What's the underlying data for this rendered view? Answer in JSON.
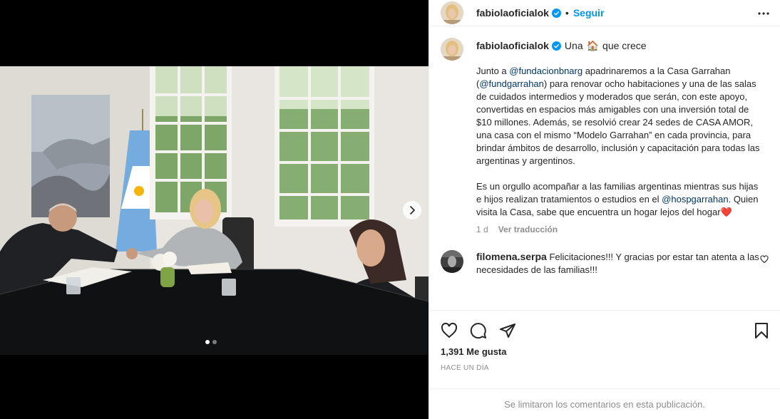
{
  "header": {
    "username": "fabiolaoficialok",
    "verified_icon": "verified-badge-icon",
    "separator": "•",
    "follow_label": "Seguir",
    "more_icon": "more-options-icon"
  },
  "caption": {
    "username": "fabiolaoficialok",
    "title_before": "Una",
    "title_emoji": "🏠",
    "title_after": "que crece",
    "p1_a": "Junto a ",
    "mention1": "@fundacionbnarg",
    "p1_b": " apadrinaremos a la Casa Garrahan (",
    "mention2": "@fundgarrahan",
    "p1_c": ") para renovar ocho habitaciones y una de las salas de cuidados intermedios y moderados que serán, con este apoyo, convertidas en espacios más amigables con una inversión total de $10 millones. Además, se resolvió crear 24 sedes de CASA AMOR, una casa con el mismo “Modelo Garrahan” en cada provincia, para brindar ámbitos de desarrollo, inclusión y capacitación para todas las argentinas y argentinos.\n\nEs un orgullo acompañar a las familias argentinas mientras sus hijas e hijos realizan tratamientos o estudios en el ",
    "mention3": "@hospgarrahan",
    "p1_d": ". Quien visita la Casa, sabe que encuentra un hogar lejos del hogar",
    "heart_emoji": "❤️",
    "age": "1 d",
    "translate_label": "Ver traducción"
  },
  "comment": {
    "username": "filomena.serpa",
    "text": "Felicitaciones!!! Y gracias por estar tan atenta a las necesidades de las familias!!!",
    "like_icon": "heart-outline-icon"
  },
  "actions": {
    "like_icon": "heart-icon",
    "comment_icon": "comment-icon",
    "share_icon": "share-icon",
    "save_icon": "bookmark-icon"
  },
  "likes_label": "1,391 Me gusta",
  "posted_ago": "HACE UN DÍA",
  "comments_limited": "Se limitaron los comentarios en esta publicación.",
  "carousel": {
    "next_icon": "chevron-right-icon",
    "slides": 2,
    "current": 1
  },
  "colors": {
    "accent": "#0095f6",
    "mention": "#00376b",
    "muted": "#8e8e8e",
    "text": "#262626",
    "verified": "#0095f6"
  }
}
